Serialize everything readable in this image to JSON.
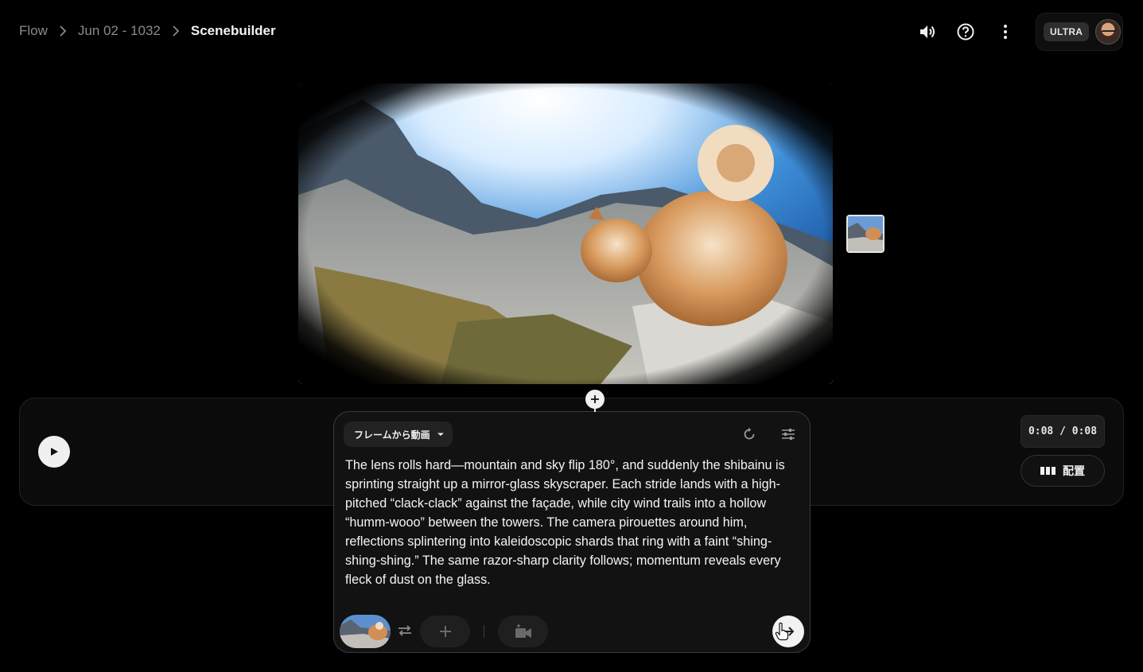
{
  "breadcrumb": {
    "items": [
      {
        "label": "Flow"
      },
      {
        "label": "Jun 02 - 1032"
      },
      {
        "label": "Scenebuilder"
      }
    ]
  },
  "header": {
    "icons": [
      "speaker-icon",
      "help-icon",
      "more-vert-icon"
    ],
    "plan_badge": "ULTRA"
  },
  "timeline": {
    "time_display": "0:08 / 0:08",
    "arrange_label": "配置"
  },
  "prompt": {
    "mode_label": "フレームから動画",
    "text": "The lens rolls hard—mountain and sky flip 180°, and suddenly the shibainu is sprinting straight up a mirror-glass skyscraper. Each stride lands with a high-pitched “clack-clack” against the façade, while city wind trails into a hollow “humm-wooo” between the towers. The camera pirouettes around him, reflections splintering into kaleidoscopic shards that ring with a faint “shing-shing-shing.” The same razor-sharp clarity follows; momentum reveals every fleck of dust on the glass."
  },
  "colors": {
    "background": "#000000",
    "panel": "#121212",
    "accent_white": "#f0f0f0"
  }
}
